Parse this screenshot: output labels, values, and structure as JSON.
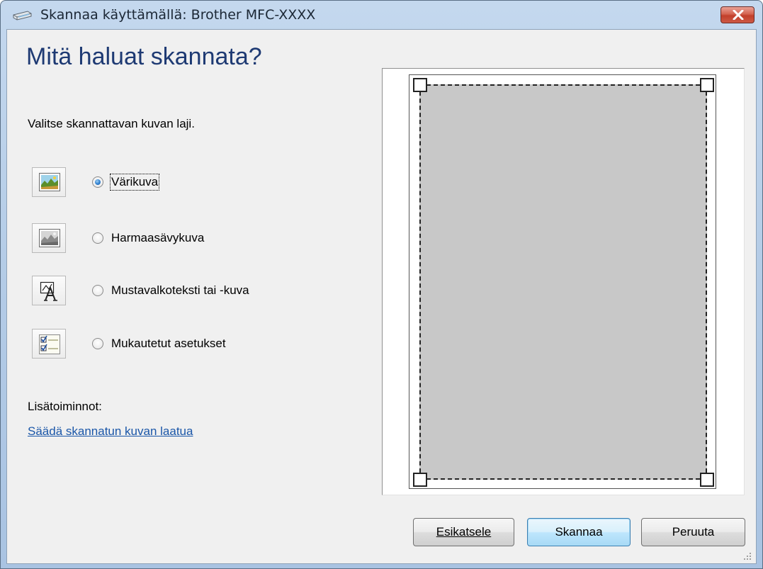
{
  "window": {
    "title": "Skannaa käyttämällä: Brother MFC-XXXX"
  },
  "main": {
    "heading": "Mitä haluat skannata?",
    "subtitle": "Valitse skannattavan kuvan laji.",
    "options": [
      {
        "label": "Värikuva",
        "icon": "color-picture-icon",
        "selected": true
      },
      {
        "label": "Harmaasävykuva",
        "icon": "grayscale-picture-icon",
        "selected": false
      },
      {
        "label": "Mustavalkoteksti tai -kuva",
        "icon": "black-white-text-icon",
        "selected": false
      },
      {
        "label": "Mukautetut asetukset",
        "icon": "custom-settings-icon",
        "selected": false
      }
    ],
    "extra_label": "Lisätoiminnot:",
    "extra_link": "Säädä skannatun kuvan laatua"
  },
  "buttons": {
    "preview": "Esikatsele",
    "scan": "Skannaa",
    "cancel": "Peruuta"
  },
  "colors": {
    "heading": "#1e3a73",
    "link": "#1a56a8",
    "scan_area": "#c8c8c8"
  }
}
